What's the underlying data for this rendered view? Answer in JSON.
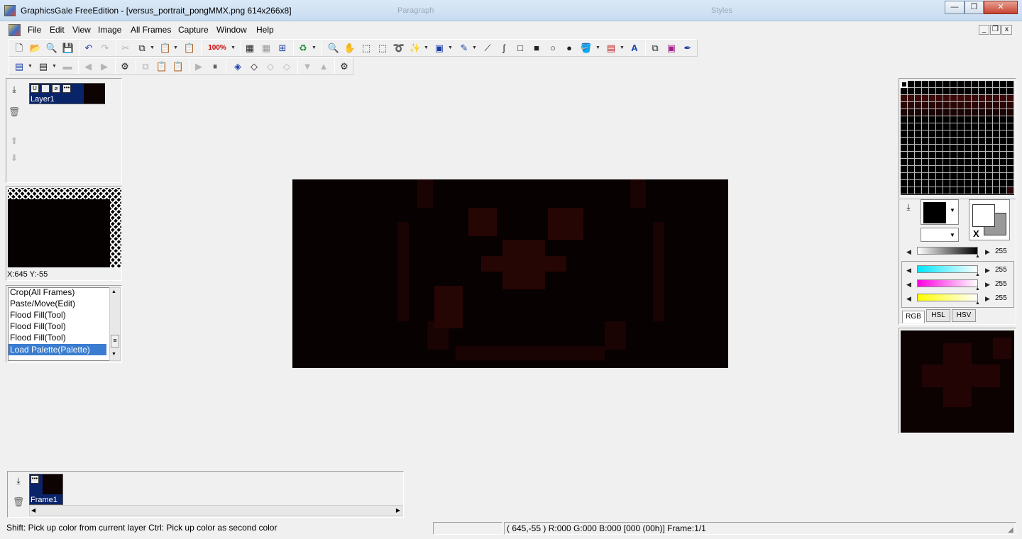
{
  "window": {
    "title": "GraphicsGale FreeEdition - [versus_portrait_pongMMX.png 614x266x8]",
    "ghost_tabs": [
      "Paragraph",
      "Styles"
    ]
  },
  "menu": {
    "items": [
      "File",
      "Edit",
      "View",
      "Image",
      "All Frames",
      "Capture",
      "Window",
      "Help"
    ]
  },
  "toolbar": {
    "zoom": "100%"
  },
  "layers": {
    "layer_name": "Layer1"
  },
  "preview": {
    "coords": "X:645 Y:-55"
  },
  "history": {
    "items": [
      "Crop(All Frames)",
      "Paste/Move(Edit)",
      "Flood Fill(Tool)",
      "Flood Fill(Tool)",
      "Flood Fill(Tool)",
      "Load Palette(Palette)"
    ],
    "selected_index": 5
  },
  "frames": {
    "frame_name": "Frame1"
  },
  "color_panel": {
    "gray_value": "255",
    "cyan_value": "255",
    "magenta_value": "255",
    "yellow_value": "255",
    "x_label": "X",
    "tabs": [
      "RGB",
      "HSL",
      "HSV"
    ],
    "active_tab": "RGB"
  },
  "status": {
    "hint": "Shift: Pick up color from current layer  Ctrl: Pick up color as second color",
    "info": "( 645,-55 ) R:000 G:000 B:000  [000 (00h)]  Frame:1/1"
  },
  "colors": {
    "canvas_bg": "#070101",
    "selection": "#0a246a",
    "history_selected": "#3a7cd0",
    "dark_red": "#2a0505"
  }
}
